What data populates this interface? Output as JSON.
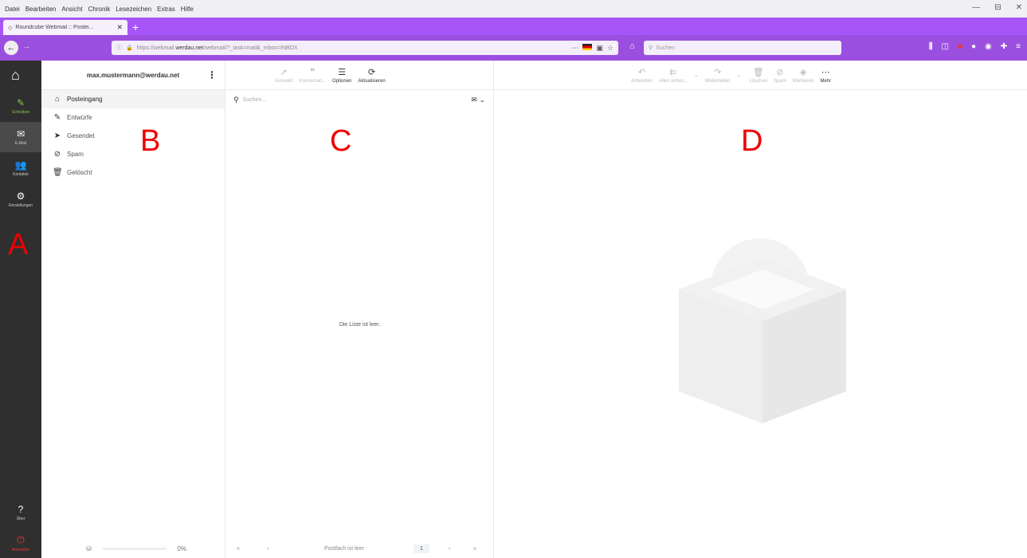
{
  "browser": {
    "menu": [
      "Datei",
      "Bearbeiten",
      "Ansicht",
      "Chronik",
      "Lesezeichen",
      "Extras",
      "Hilfe"
    ],
    "window_controls": [
      "—",
      "⊟",
      "✕"
    ],
    "tab_title": "Roundcube Webmail :: Postei...",
    "url_prefix": "https://webmail.",
    "url_host": "werdau.net",
    "url_path": "/webmail/?_task=mail&_mbox=INBOX",
    "search_placeholder": "Suchen"
  },
  "rail": {
    "compose": "Schreiben",
    "mail": "E-Mail",
    "contacts": "Kontakte",
    "settings": "Einstellungen",
    "about": "Über",
    "logout": "Abmelden"
  },
  "account": {
    "email": "max.mustermann@werdau.net"
  },
  "folders": [
    {
      "label": "Posteingang",
      "icon": "inbox-icon",
      "glyph": "⌂"
    },
    {
      "label": "Entwürfe",
      "icon": "pencil-icon",
      "glyph": "✎"
    },
    {
      "label": "Gesendet",
      "icon": "send-icon",
      "glyph": "➤"
    },
    {
      "label": "Spam",
      "icon": "spam-icon",
      "glyph": "⊘"
    },
    {
      "label": "Gelöscht",
      "icon": "trash-icon",
      "glyph": "🗑"
    }
  ],
  "quota": "0%",
  "list_toolbar": [
    "Auswahl",
    "Konversati...",
    "Optionen",
    "Aktualisieren"
  ],
  "list": {
    "search_placeholder": "Suchen...",
    "empty": "Die Liste ist leer.",
    "pager_label": "Postfach ist leer",
    "page": "1"
  },
  "message_toolbar": [
    "Antworten",
    "Allen antwo...",
    "Weiterleiten",
    "Löschen",
    "Spam",
    "Markieren",
    "Mehr"
  ],
  "overlay_labels": {
    "a": "A",
    "b": "B",
    "c": "C",
    "d": "D"
  },
  "colors": {
    "browser_accent": "#9b4fdf",
    "rail_bg": "#2f2f2f",
    "overlay_red": "#e00000"
  }
}
